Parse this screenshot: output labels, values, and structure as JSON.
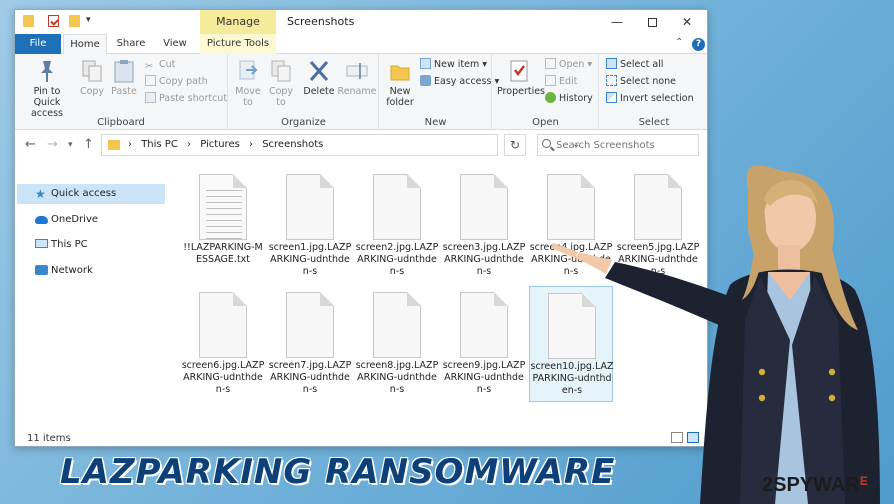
{
  "window": {
    "title": "Screenshots",
    "context_group": "Manage",
    "controls": {
      "minimize": "—",
      "close": "✕"
    }
  },
  "tabs": [
    {
      "label": "File"
    },
    {
      "label": "Home"
    },
    {
      "label": "Share"
    },
    {
      "label": "View"
    },
    {
      "label": "Picture Tools"
    }
  ],
  "ribbon": {
    "clipboard": {
      "label": "Clipboard",
      "pin": "Pin to Quick access",
      "copy": "Copy",
      "paste": "Paste",
      "cut": "Cut",
      "copy_path": "Copy path",
      "paste_shortcut": "Paste shortcut"
    },
    "organize": {
      "label": "Organize",
      "move_to": "Move to",
      "copy_to": "Copy to",
      "delete": "Delete",
      "rename": "Rename"
    },
    "new": {
      "label": "New",
      "new_folder": "New folder",
      "new_item": "New item",
      "easy_access": "Easy access"
    },
    "open": {
      "label": "Open",
      "properties": "Properties",
      "open": "Open",
      "edit": "Edit",
      "history": "History"
    },
    "select": {
      "label": "Select",
      "select_all": "Select all",
      "select_none": "Select none",
      "invert": "Invert selection"
    }
  },
  "address": {
    "crumbs": [
      "This PC",
      "Pictures",
      "Screenshots"
    ],
    "search_placeholder": "Search Screenshots"
  },
  "nav": [
    {
      "label": "Quick access",
      "icon": "star-icon"
    },
    {
      "label": "OneDrive",
      "icon": "cloud-icon"
    },
    {
      "label": "This PC",
      "icon": "computer-icon"
    },
    {
      "label": "Network",
      "icon": "network-icon"
    }
  ],
  "files": [
    {
      "name": "!!LAZPARKING-MESSAGE.txt",
      "type": "txt"
    },
    {
      "name": "screen1.jpg.LAZPARKING-udnthden-s",
      "type": "blank"
    },
    {
      "name": "screen2.jpg.LAZPARKING-udnthden-s",
      "type": "blank"
    },
    {
      "name": "screen3.jpg.LAZPARKING-udnthden-s",
      "type": "blank"
    },
    {
      "name": "screen4.jpg.LAZPARKING-udnthden-s",
      "type": "blank"
    },
    {
      "name": "screen5.jpg.LAZPARKING-udnthden-s",
      "type": "blank"
    },
    {
      "name": "screen6.jpg.LAZPARKING-udnthden-s",
      "type": "blank"
    },
    {
      "name": "screen7.jpg.LAZPARKING-udnthden-s",
      "type": "blank"
    },
    {
      "name": "screen8.jpg.LAZPARKING-udnthden-s",
      "type": "blank"
    },
    {
      "name": "screen9.jpg.LAZPARKING-udnthden-s",
      "type": "blank"
    },
    {
      "name": "screen10.jpg.LAZPARKING-udnthden-s",
      "type": "blank",
      "selected": true
    }
  ],
  "status": {
    "items": "11 items"
  },
  "banner": {
    "text": "LAZPARKING RANSOMWARE"
  },
  "logo": {
    "prefix": "2",
    "text": "SPYWAR",
    "suffix": "E"
  },
  "colors": {
    "accent": "#1e6fb8",
    "banner": "#0d3f78",
    "context_tab": "#f6eb9b",
    "selection": "#cce4f7"
  }
}
